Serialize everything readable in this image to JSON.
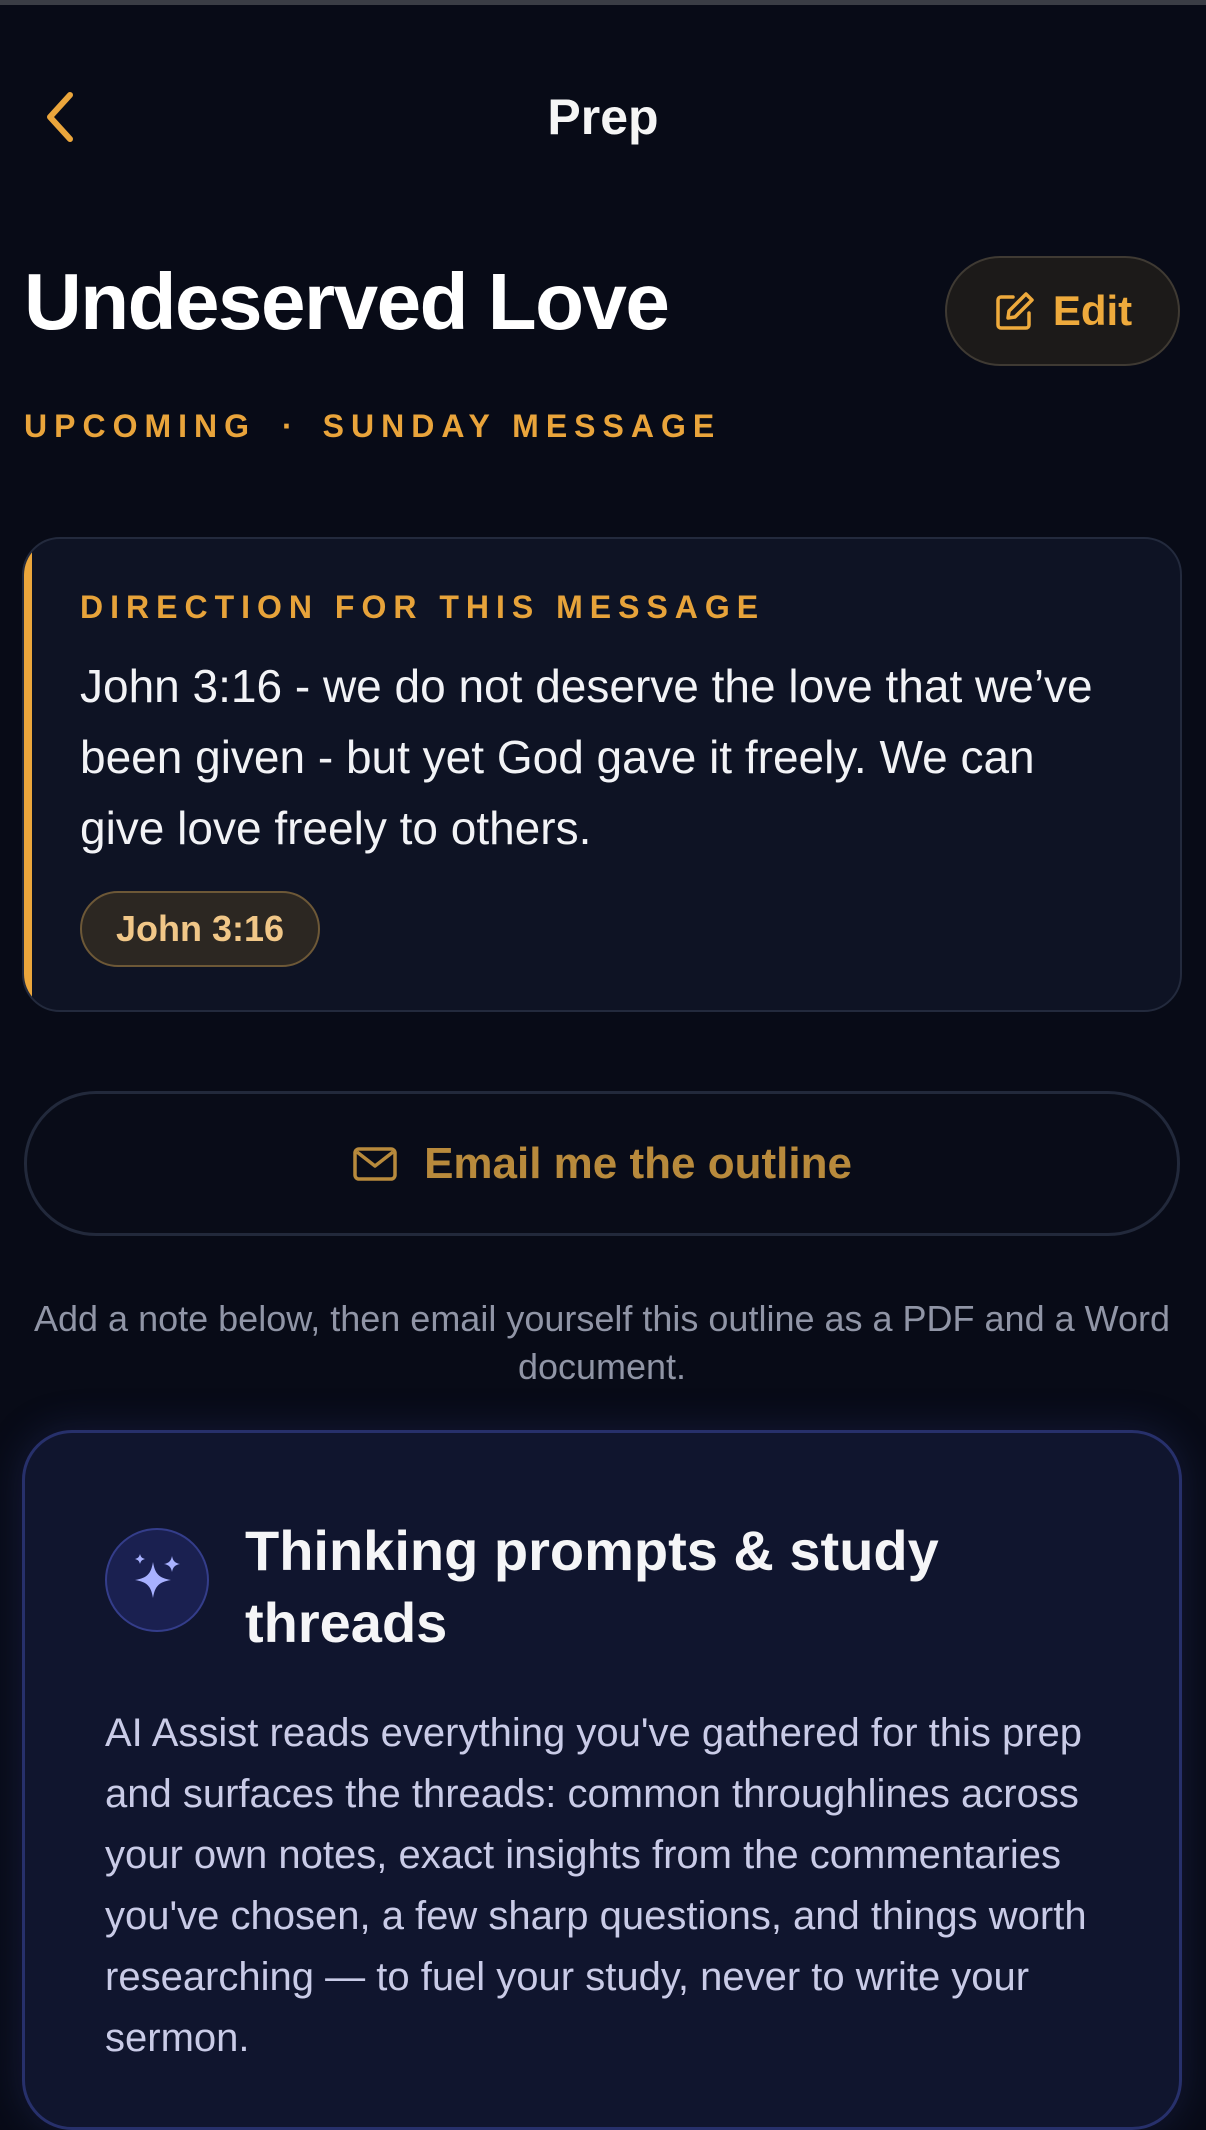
{
  "nav": {
    "title": "Prep",
    "back_icon": "chevron-left-icon"
  },
  "header": {
    "title": "Undeserved Love",
    "edit_label": "Edit",
    "edit_icon": "edit-icon",
    "status": "UPCOMING",
    "separator": "·",
    "type": "SUNDAY MESSAGE"
  },
  "direction": {
    "label": "DIRECTION FOR THIS MESSAGE",
    "text": "John 3:16 - we do not deserve the love that we’ve been given - but yet God gave it freely. We can give love freely to others.",
    "verse": "John 3:16"
  },
  "email": {
    "button_label": "Email me the outline",
    "icon": "mail-icon",
    "help": "Add a note below, then email yourself this outline as a PDF and a Word document."
  },
  "prompts": {
    "icon": "sparkles-icon",
    "title": "Thinking prompts & study threads",
    "body": "AI Assist reads everything you've gathered for this prep and surfaces the threads: common throughlines across your own notes, exact insights from the commentaries you've chosen, a few sharp questions, and things worth researching — to fuel your study, never to write your sermon."
  },
  "colors": {
    "background": "#080b17",
    "accent": "#eba63c",
    "card": "#0e1324",
    "ai_card": "#10152e",
    "ai_accent": "#8f9cff"
  }
}
